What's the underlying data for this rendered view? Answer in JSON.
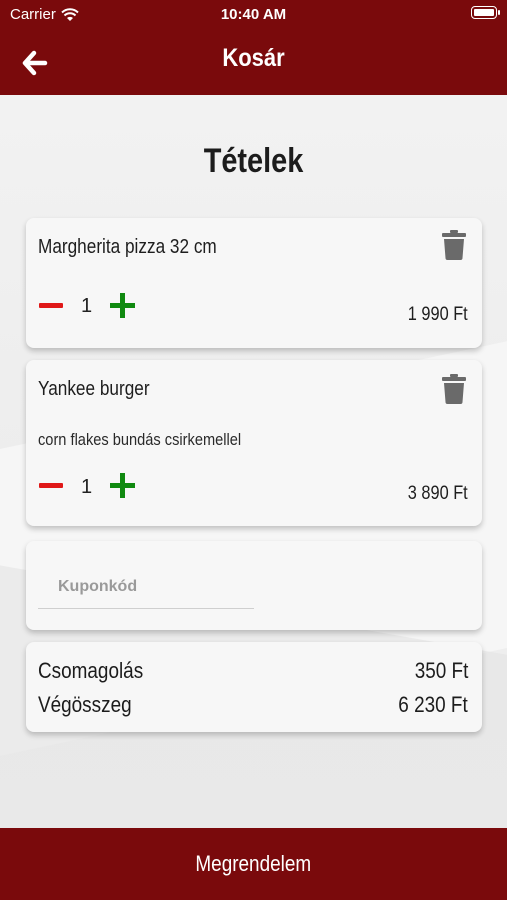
{
  "status_bar": {
    "carrier": "Carrier",
    "time": "10:40 AM"
  },
  "header": {
    "title": "Kosár",
    "back_icon": "arrow-left-icon"
  },
  "page": {
    "heading": "Tételek"
  },
  "cart_items": [
    {
      "name": "Margherita pizza 32 cm",
      "description": "",
      "quantity": "1",
      "price": "1 990 Ft"
    },
    {
      "name": "Yankee burger",
      "description": "corn flakes bundás csirkemellel",
      "quantity": "1",
      "price": "3 890 Ft"
    }
  ],
  "coupon": {
    "placeholder": "Kuponkód",
    "value": ""
  },
  "summary": {
    "packaging_label": "Csomagolás",
    "packaging_value": "350 Ft",
    "total_label": "Végösszeg",
    "total_value": "6 230 Ft"
  },
  "order_button": {
    "label": "Megrendelem"
  },
  "colors": {
    "brand": "#7a0a0c",
    "minus": "#e01818",
    "plus": "#108a10",
    "trash": "#6a6a6a"
  }
}
